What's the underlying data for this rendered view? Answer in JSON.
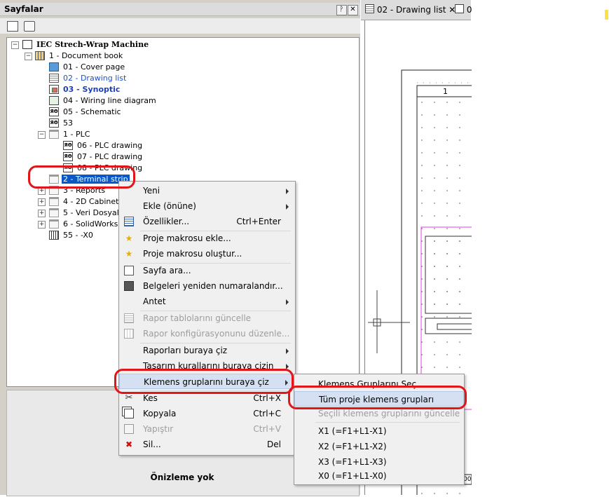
{
  "panel": {
    "title": "Sayfalar",
    "pin_glyph": "ᚹ",
    "close_glyph": "✕"
  },
  "tree": {
    "project": "IEC Strech-Wrap Machine",
    "book": "1 - Document book",
    "items": [
      {
        "label": "01 - Cover page",
        "icon": "cover-page-icon"
      },
      {
        "label": "02 - Drawing list",
        "icon": "drawing-list-icon"
      },
      {
        "label": "03 - Synoptic",
        "icon": "synoptic-icon"
      },
      {
        "label": "04 - Wiring line diagram",
        "icon": "wiring-diagram-icon"
      },
      {
        "label": "05 - Schematic",
        "icon": "schematic-icon"
      },
      {
        "label": "53",
        "icon": "schematic-icon"
      }
    ],
    "plc_folder": "1 - PLC",
    "plc_items": [
      {
        "label": "06 - PLC drawing"
      },
      {
        "label": "07 - PLC drawing"
      },
      {
        "label": "08 - PLC drawing"
      }
    ],
    "selected": "2 - Terminal strip",
    "folders": [
      {
        "label": "3 - Reports"
      },
      {
        "label": "4 - 2D Cabinet la"
      },
      {
        "label": "5 - Veri Dosyalar"
      },
      {
        "label": "6 - SolidWorks"
      }
    ],
    "terminal": "55 - -X0",
    "schematic_glyph": "ЯΘ"
  },
  "preview": {
    "label": "Önizleme yok"
  },
  "tabs": [
    {
      "label": "02 - Drawing list",
      "close": "✕"
    },
    {
      "label": "0"
    }
  ],
  "drawing": {
    "cell_number": "1",
    "bottom_label": "00"
  },
  "context_menu": {
    "items": [
      {
        "label": "Yeni",
        "shortcut": "",
        "submenu": true,
        "disabled": false,
        "icon": ""
      },
      {
        "label": "Ekle (önüne)",
        "shortcut": "",
        "submenu": true,
        "disabled": false,
        "icon": ""
      },
      {
        "label": "Özellikler...",
        "shortcut": "Ctrl+Enter",
        "submenu": false,
        "disabled": false,
        "icon": "properties-icon"
      },
      {
        "label": "Proje makrosu ekle...",
        "shortcut": "",
        "submenu": false,
        "disabled": false,
        "icon": "star-icon"
      },
      {
        "label": "Proje makrosu oluştur...",
        "shortcut": "",
        "submenu": false,
        "disabled": false,
        "icon": "star-icon"
      },
      {
        "label": "Sayfa ara...",
        "shortcut": "",
        "submenu": false,
        "disabled": false,
        "icon": "search-page-icon"
      },
      {
        "label": "Belgeleri yeniden numaralandır...",
        "shortcut": "",
        "submenu": false,
        "disabled": false,
        "icon": "renumber-icon"
      },
      {
        "label": "Antet",
        "shortcut": "",
        "submenu": true,
        "disabled": false,
        "icon": ""
      },
      {
        "label": "Rapor tablolarını güncelle",
        "shortcut": "",
        "submenu": false,
        "disabled": true,
        "icon": "report-table-icon"
      },
      {
        "label": "Rapor konfigürasyonunu düzenle...",
        "shortcut": "",
        "submenu": false,
        "disabled": true,
        "icon": "report-config-icon"
      },
      {
        "label": "Raporları buraya çiz",
        "shortcut": "",
        "submenu": true,
        "disabled": false,
        "icon": ""
      },
      {
        "label": "Tasarım kurallarını buraya çizin",
        "shortcut": "",
        "submenu": true,
        "disabled": false,
        "icon": ""
      },
      {
        "label": "Klemens gruplarını buraya çiz",
        "shortcut": "",
        "submenu": true,
        "disabled": false,
        "icon": ""
      },
      {
        "label": "Kes",
        "shortcut": "Ctrl+X",
        "submenu": false,
        "disabled": false,
        "icon": "cut-icon"
      },
      {
        "label": "Kopyala",
        "shortcut": "Ctrl+C",
        "submenu": false,
        "disabled": false,
        "icon": "copy-icon"
      },
      {
        "label": "Yapıştır",
        "shortcut": "Ctrl+V",
        "submenu": false,
        "disabled": true,
        "icon": "paste-icon"
      },
      {
        "label": "Sil...",
        "shortcut": "Del",
        "submenu": false,
        "disabled": false,
        "icon": "delete-icon"
      }
    ],
    "glyphs": {
      "star": "★",
      "cut": "✂",
      "delete": "✖",
      "search": "🔍"
    }
  },
  "submenu": {
    "items": [
      {
        "label": "Klemens Gruplarını Seç..."
      },
      {
        "label": "Tüm proje klemens grupları"
      },
      {
        "label": "Seçili klemens gruplarını güncelle"
      },
      {
        "label": "X1 (=F1+L1-X1)"
      },
      {
        "label": "X2 (=F1+L1-X2)"
      },
      {
        "label": "X3 (=F1+L1-X3)"
      },
      {
        "label": "X0 (=F1+L1-X0)"
      }
    ]
  },
  "colors": {
    "selection": "#0a58c8",
    "highlight_ring": "#e0161b",
    "menu_hover": "#d5e1f2"
  }
}
